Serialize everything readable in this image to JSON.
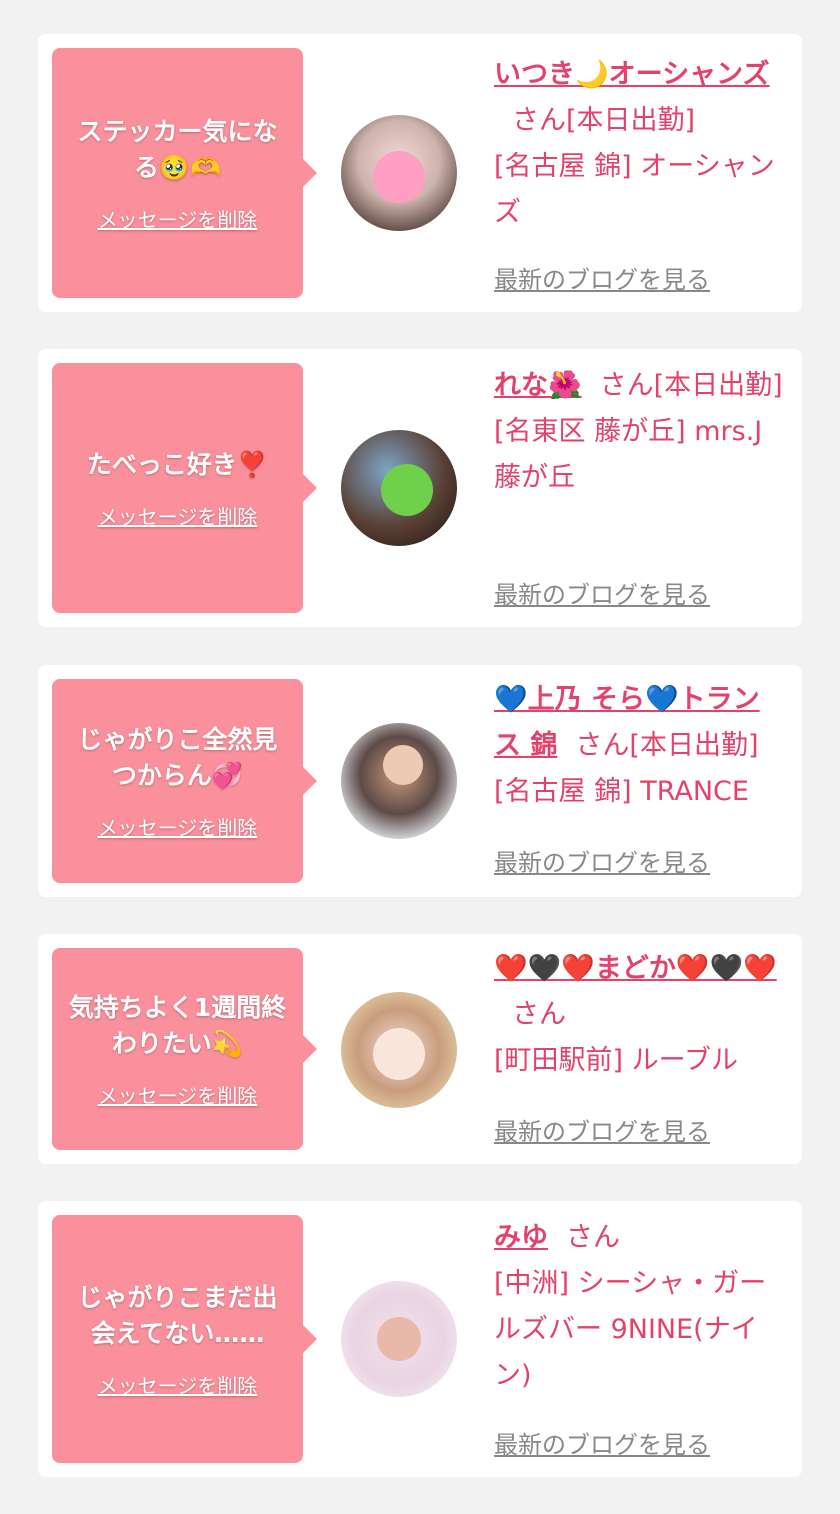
{
  "delete_label": "メッセージを削除",
  "blog_label": "最新のブログを見る",
  "honorific": "さん",
  "cards": [
    {
      "message": "ステッカー気になる🥹🫶",
      "name": "いつき🌙オーシャンズ",
      "status": "[本日出勤]",
      "shop": "[名古屋 錦] オーシャンズ",
      "avatar_icon": "pink-heart-sticker-icon"
    },
    {
      "message": "たべっこ好き❣️",
      "name": "れな🌺",
      "status": "[本日出勤]",
      "shop": "[名東区 藤が丘] mrs.J 藤が丘",
      "avatar_icon": "green-heart-sticker-icon"
    },
    {
      "message": "じゃがりこ全然見つからん💞",
      "name": "💙上乃 そら💙トランス 錦",
      "status": "[本日出勤]",
      "shop": "[名古屋 錦] TRANCE",
      "avatar_icon": "portrait-photo"
    },
    {
      "message": "気持ちよく1週間終わりたい💫",
      "name": "❤️🖤❤️まどか❤️🖤❤️",
      "status": "",
      "shop": "[町田駅前] ルーブル",
      "avatar_icon": "portrait-photo"
    },
    {
      "message": "じゃがりこまだ出会えてない……",
      "name": "みゆ",
      "status": "",
      "shop": "[中洲] シーシャ・ガールズバー 9NINE(ナイン)",
      "avatar_icon": "portrait-photo"
    }
  ],
  "colors": {
    "page_bg": "#f2f2f2",
    "bubble": "#f9909c",
    "accent_text": "#e2426b",
    "link_gray": "#888888"
  }
}
